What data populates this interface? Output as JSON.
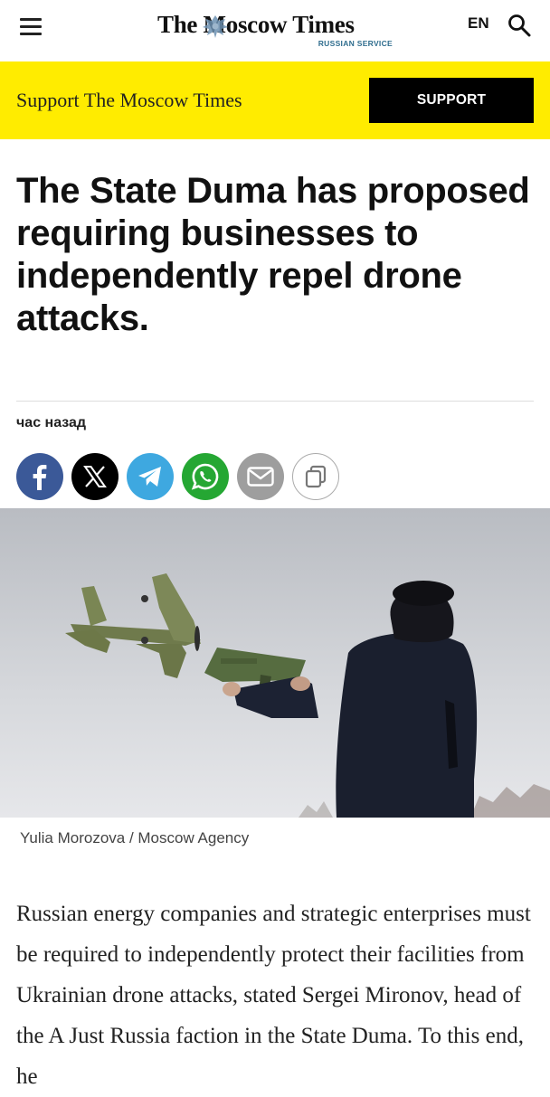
{
  "header": {
    "logo_title": "The Moscow Times",
    "logo_subtitle": "RUSSIAN SERVICE",
    "language": "EN",
    "menu_icon": "hamburger-menu-icon",
    "search_icon": "search-icon"
  },
  "banner": {
    "text": "Support The Moscow Times",
    "button_label": "SUPPORT",
    "color": "#ffec00"
  },
  "article": {
    "headline": "The State Duma has proposed requiring businesses to independently repel drone attacks.",
    "timestamp": "час назад",
    "photo_caption": "Yulia Morozova / Moscow Agency",
    "body_text": "Russian energy companies and strategic enterprises must be required to independently protect their facilities from Ukrainian drone attacks, stated Sergei Mironov, head of the A Just Russia faction in the State Duma. To this end, he"
  },
  "share": [
    {
      "icon": "facebook-icon",
      "color": "#3b5998"
    },
    {
      "icon": "x-icon",
      "color": "#000000"
    },
    {
      "icon": "telegram-icon",
      "color": "#2ca5e0"
    },
    {
      "icon": "whatsapp-icon",
      "color": "#25a733"
    },
    {
      "icon": "email-icon",
      "color": "#9e9e9e"
    },
    {
      "icon": "copy-link-icon",
      "color": "#ffffff"
    }
  ]
}
